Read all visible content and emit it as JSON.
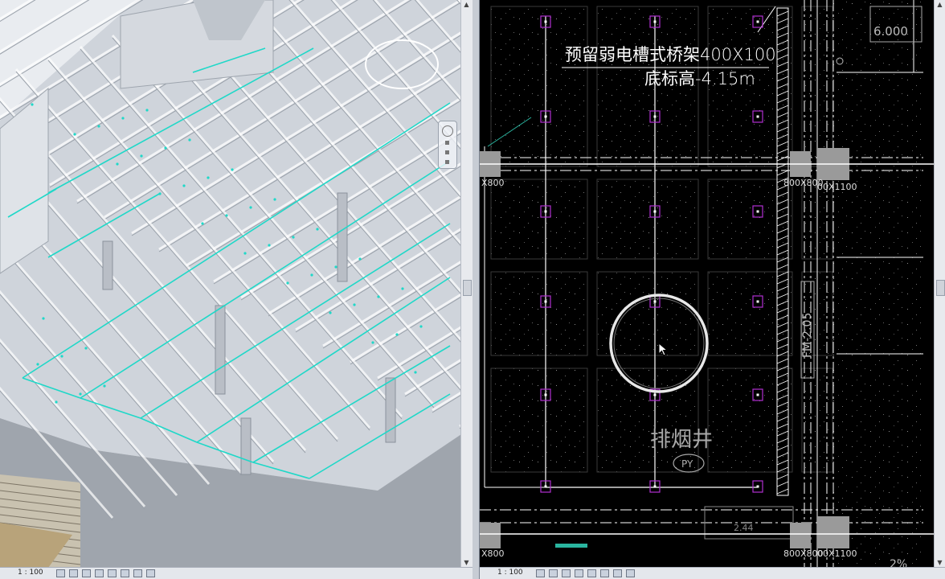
{
  "left_view": {
    "view_type": "3D building model",
    "status": {
      "scale": "1 : 100"
    },
    "accent_color": "#1fd8c8"
  },
  "right_view": {
    "view_type": "CAD floor plan",
    "annotations": {
      "tray_label": "预留弱电槽式桥架400X100",
      "elevation_label": "底标高-4.15m",
      "shaft_label": "排烟井",
      "shaft_tag": "PY",
      "beam_size_left": "X800",
      "beam_size_mid": "800X800",
      "beam_size_right": "00X1100",
      "beam_size_bottom_left": "X800",
      "beam_size_bottom_mid": "800X800",
      "beam_size_bottom_right": "00X1100",
      "top_right_value": "6.000",
      "vertical_label": "FM-2.05",
      "bottom_dim": "2.44",
      "bottom_fraction": "2%"
    },
    "status": {
      "scale": "1 : 100"
    },
    "colors": {
      "lines": "#ffffff",
      "column_markers": "#b030d0",
      "leader": "#2ab5a0",
      "column_fill": "#9a9a9a"
    }
  }
}
